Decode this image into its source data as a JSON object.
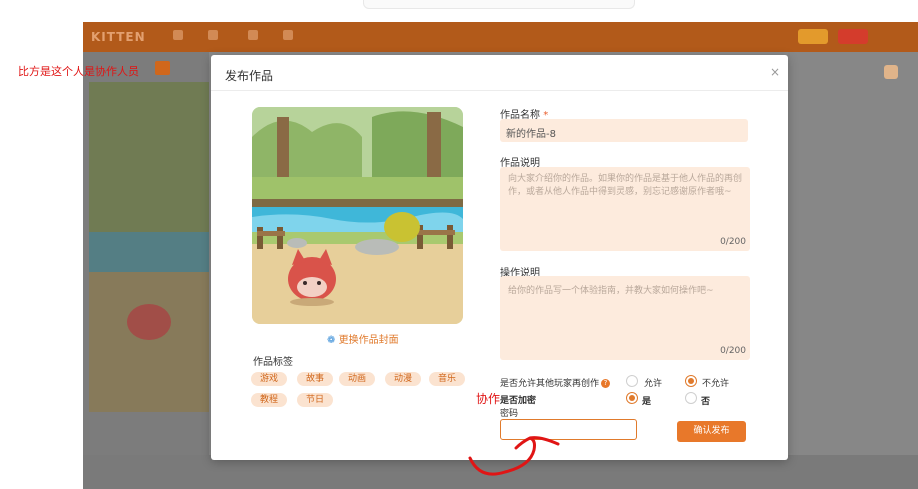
{
  "annotation": {
    "note": "比方是这个人是协作人员",
    "label": "协作"
  },
  "background_app": {
    "logo": "KITTEN"
  },
  "dialog": {
    "title": "发布作品",
    "close": "×",
    "change_cover": "更换作品封面",
    "tags_label": "作品标签",
    "tags": [
      "游戏",
      "故事",
      "动画",
      "动漫",
      "音乐",
      "教程",
      "节日"
    ],
    "name_label": "作品名称",
    "required_mark": "*",
    "name_value": "新的作品-8",
    "desc_label": "作品说明",
    "desc_placeholder": "向大家介绍你的作品。如果你的作品是基于他人作品的再创作，或者从他人作品中得到灵感，别忘记感谢原作者哦~",
    "desc_counter": "0/200",
    "op_label": "操作说明",
    "op_placeholder": "给你的作品写一个体验指南，并教大家如何操作吧~",
    "op_counter": "0/200",
    "remix_label": "是否允许其他玩家再创作",
    "remix_allow": "允许",
    "remix_deny": "不允许",
    "remix_selected": "不允许",
    "encrypt_label": "是否加密",
    "encrypt_yes": "是",
    "encrypt_no": "否",
    "encrypt_selected": "是",
    "password_label": "密码",
    "confirm": "确认发布"
  },
  "colors": {
    "accent": "#e8782a",
    "field_bg": "#fdebdd",
    "annotation": "#e01515"
  }
}
